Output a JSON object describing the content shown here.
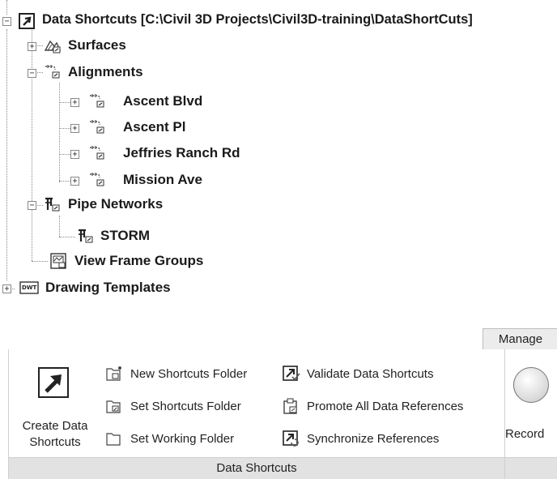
{
  "tree": {
    "root": {
      "label": "Data Shortcuts [C:\\Civil 3D Projects\\Civil3D-training\\DataShortCuts]",
      "expander": "−"
    },
    "surfaces": {
      "label": "Surfaces",
      "expander": "+"
    },
    "alignments": {
      "label": "Alignments",
      "expander": "−",
      "items": [
        {
          "label": "Ascent Blvd",
          "expander": "+"
        },
        {
          "label": "Ascent Pl",
          "expander": "+"
        },
        {
          "label": "Jeffries Ranch Rd",
          "expander": "+"
        },
        {
          "label": "Mission Ave",
          "expander": "+"
        }
      ]
    },
    "pipe_networks": {
      "label": "Pipe Networks",
      "expander": "−",
      "items": [
        {
          "label": "STORM"
        }
      ]
    },
    "view_frame_groups": {
      "label": "View Frame Groups"
    },
    "drawing_templates": {
      "label": "Drawing Templates",
      "expander": "+",
      "icon_text": "DWT"
    }
  },
  "ribbon": {
    "tab_label": "Manage",
    "panel_title": "Data Shortcuts",
    "create_button": {
      "line1": "Create Data",
      "line2": "Shortcuts"
    },
    "new_shortcuts_folder": "New Shortcuts Folder",
    "set_shortcuts_folder": "Set Shortcuts Folder",
    "set_working_folder": "Set Working Folder",
    "validate_data_shortcuts": "Validate Data Shortcuts",
    "promote_all_data_references": "Promote All Data References",
    "synchronize_references": "Synchronize References",
    "record_button": "Record"
  },
  "colors": {
    "ribbon_title_bg": "#e2e2e2",
    "tab_bg": "#ececec",
    "border": "#cfcfcf"
  }
}
